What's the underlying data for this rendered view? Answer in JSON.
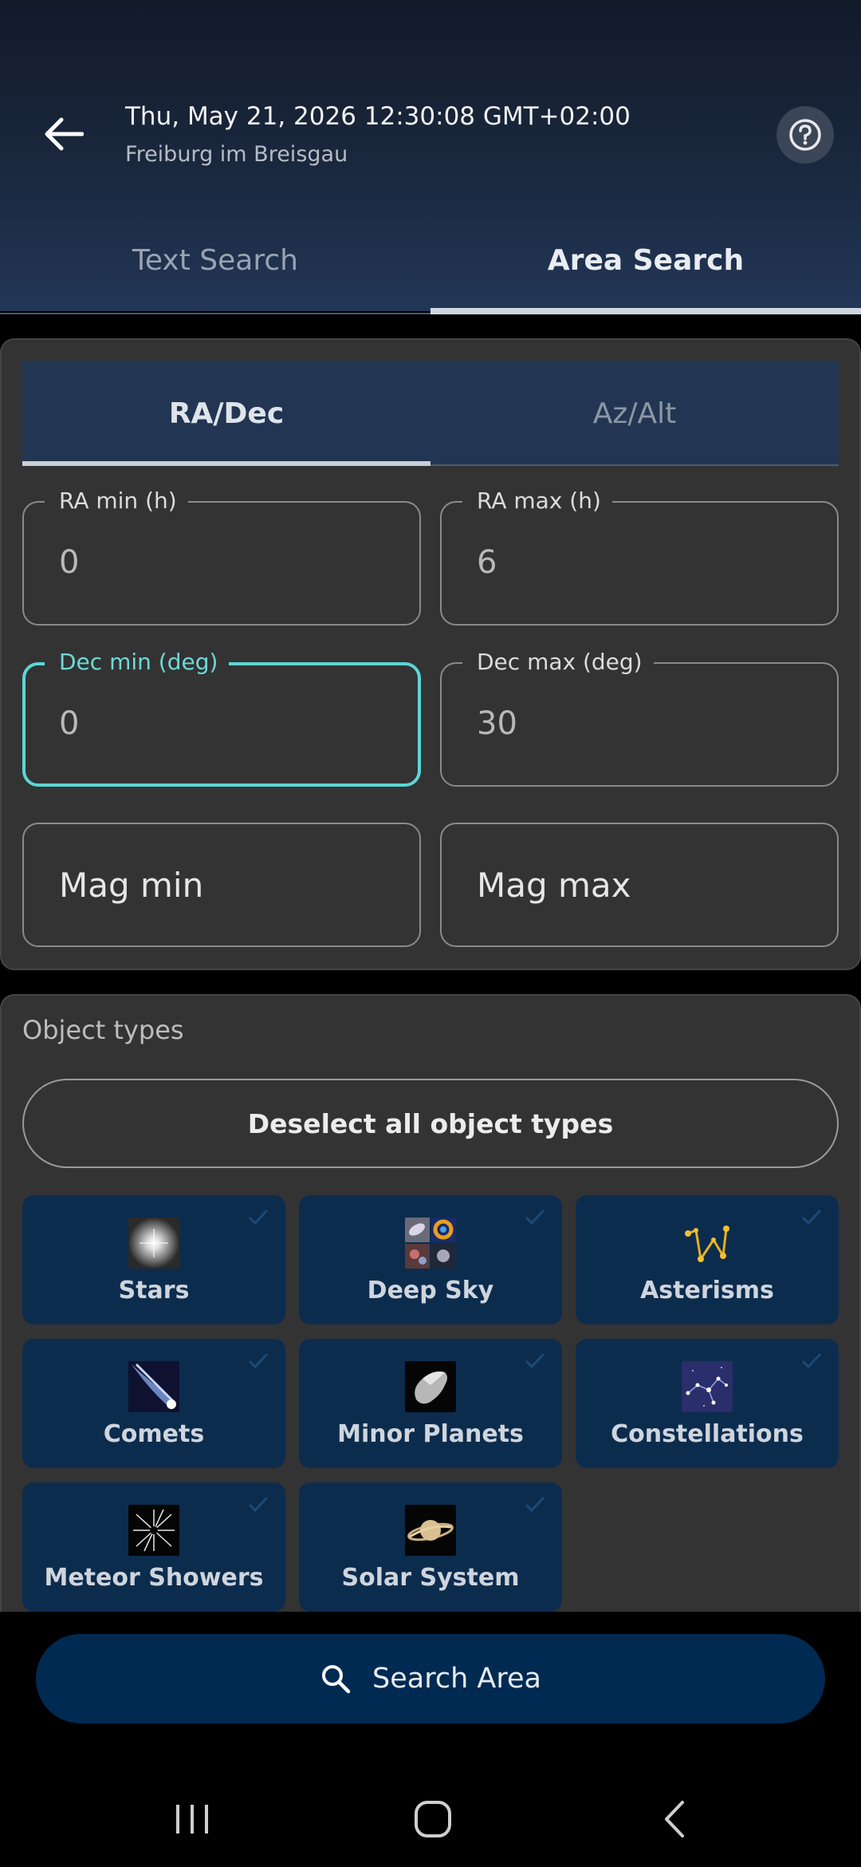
{
  "header": {
    "datetime": "Thu, May 21, 2026 12:30:08 GMT+02:00",
    "location": "Freiburg im Breisgau"
  },
  "tabs": [
    {
      "label": "Text Search",
      "active": false
    },
    {
      "label": "Area Search",
      "active": true
    }
  ],
  "coord_tabs": [
    {
      "label": "RA/Dec",
      "active": true
    },
    {
      "label": "Az/Alt",
      "active": false
    }
  ],
  "fields": {
    "ra_min": {
      "label": "RA min (h)",
      "value": "0"
    },
    "ra_max": {
      "label": "RA max (h)",
      "value": "6"
    },
    "dec_min": {
      "label": "Dec min (deg)",
      "value": "0",
      "focused": true
    },
    "dec_max": {
      "label": "Dec max (deg)",
      "value": "30"
    },
    "mag_min": {
      "placeholder": "Mag min"
    },
    "mag_max": {
      "placeholder": "Mag max"
    }
  },
  "object_types": {
    "title": "Object types",
    "deselect_label": "Deselect all object types",
    "items": [
      {
        "label": "Stars",
        "icon": "stars-icon",
        "selected": true
      },
      {
        "label": "Deep Sky",
        "icon": "deep-sky-icon",
        "selected": true
      },
      {
        "label": "Asterisms",
        "icon": "asterisms-icon",
        "selected": true
      },
      {
        "label": "Comets",
        "icon": "comets-icon",
        "selected": true
      },
      {
        "label": "Minor Planets",
        "icon": "minor-planets-icon",
        "selected": true
      },
      {
        "label": "Constellations",
        "icon": "constellations-icon",
        "selected": true
      },
      {
        "label": "Meteor Showers",
        "icon": "meteor-showers-icon",
        "selected": true
      },
      {
        "label": "Solar System",
        "icon": "solar-system-icon",
        "selected": true
      }
    ]
  },
  "search_button": {
    "label": "Search Area"
  },
  "colors": {
    "accent_focus": "#5cd6d6",
    "tile_bg": "#0c2c4e",
    "button_bg": "#012a52",
    "header_bg": "#223656"
  }
}
